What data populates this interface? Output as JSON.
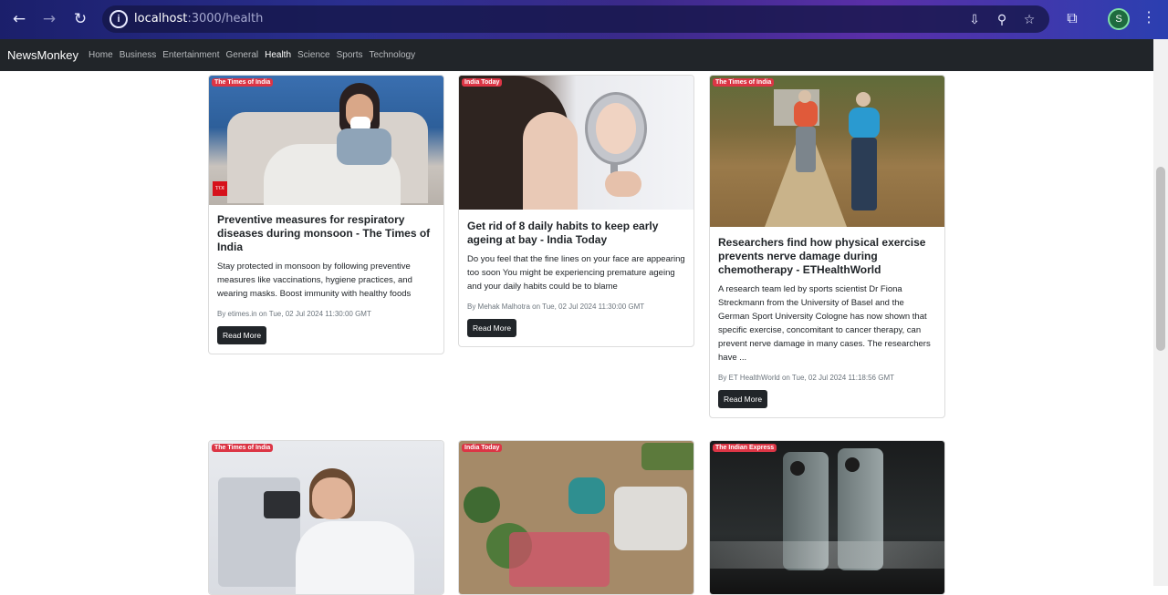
{
  "browser": {
    "url_host": "localhost",
    "url_path": ":3000/health",
    "profile_initial": "S"
  },
  "navbar": {
    "brand": "NewsMonkey",
    "links": [
      "Home",
      "Business",
      "Entertainment",
      "General",
      "Health",
      "Science",
      "Sports",
      "Technology"
    ],
    "active": "Health"
  },
  "cards": [
    {
      "source": "The Times of India",
      "title": "Preventive measures for respiratory diseases during monsoon - The Times of India",
      "description": "Stay protected in monsoon by following preventive measures like vaccinations, hygiene practices, and wearing masks. Boost immunity with healthy foods",
      "meta": "By etimes.in on Tue, 02 Jul 2024 11:30:00 GMT",
      "button": "Read More",
      "image_logo": "TOI"
    },
    {
      "source": "India Today",
      "title": "Get rid of 8 daily habits to keep early ageing at bay - India Today",
      "description": "Do you feel that the fine lines on your face are appearing too soon You might be experiencing premature ageing and your daily habits could be to blame",
      "meta": "By Mehak Malhotra on Tue, 02 Jul 2024 11:30:00 GMT",
      "button": "Read More"
    },
    {
      "source": "The Times of India",
      "title": "Researchers find how physical exercise prevents nerve damage during chemotherapy - ETHealthWorld",
      "description": "A research team led by sports scientist Dr Fiona Streckmann from the University of Basel and the German Sport University Cologne has now shown that specific exercise, concomitant to cancer therapy, can prevent nerve damage in many cases. The researchers have ...",
      "meta": "By ET HealthWorld on Tue, 02 Jul 2024 11:18:56 GMT",
      "button": "Read More"
    },
    {
      "source": "The Times of India"
    },
    {
      "source": "India Today"
    },
    {
      "source": "The Indian Express"
    }
  ],
  "colors": {
    "navbar_bg": "#212529",
    "badge_bg": "#dc3545",
    "button_bg": "#212529"
  }
}
